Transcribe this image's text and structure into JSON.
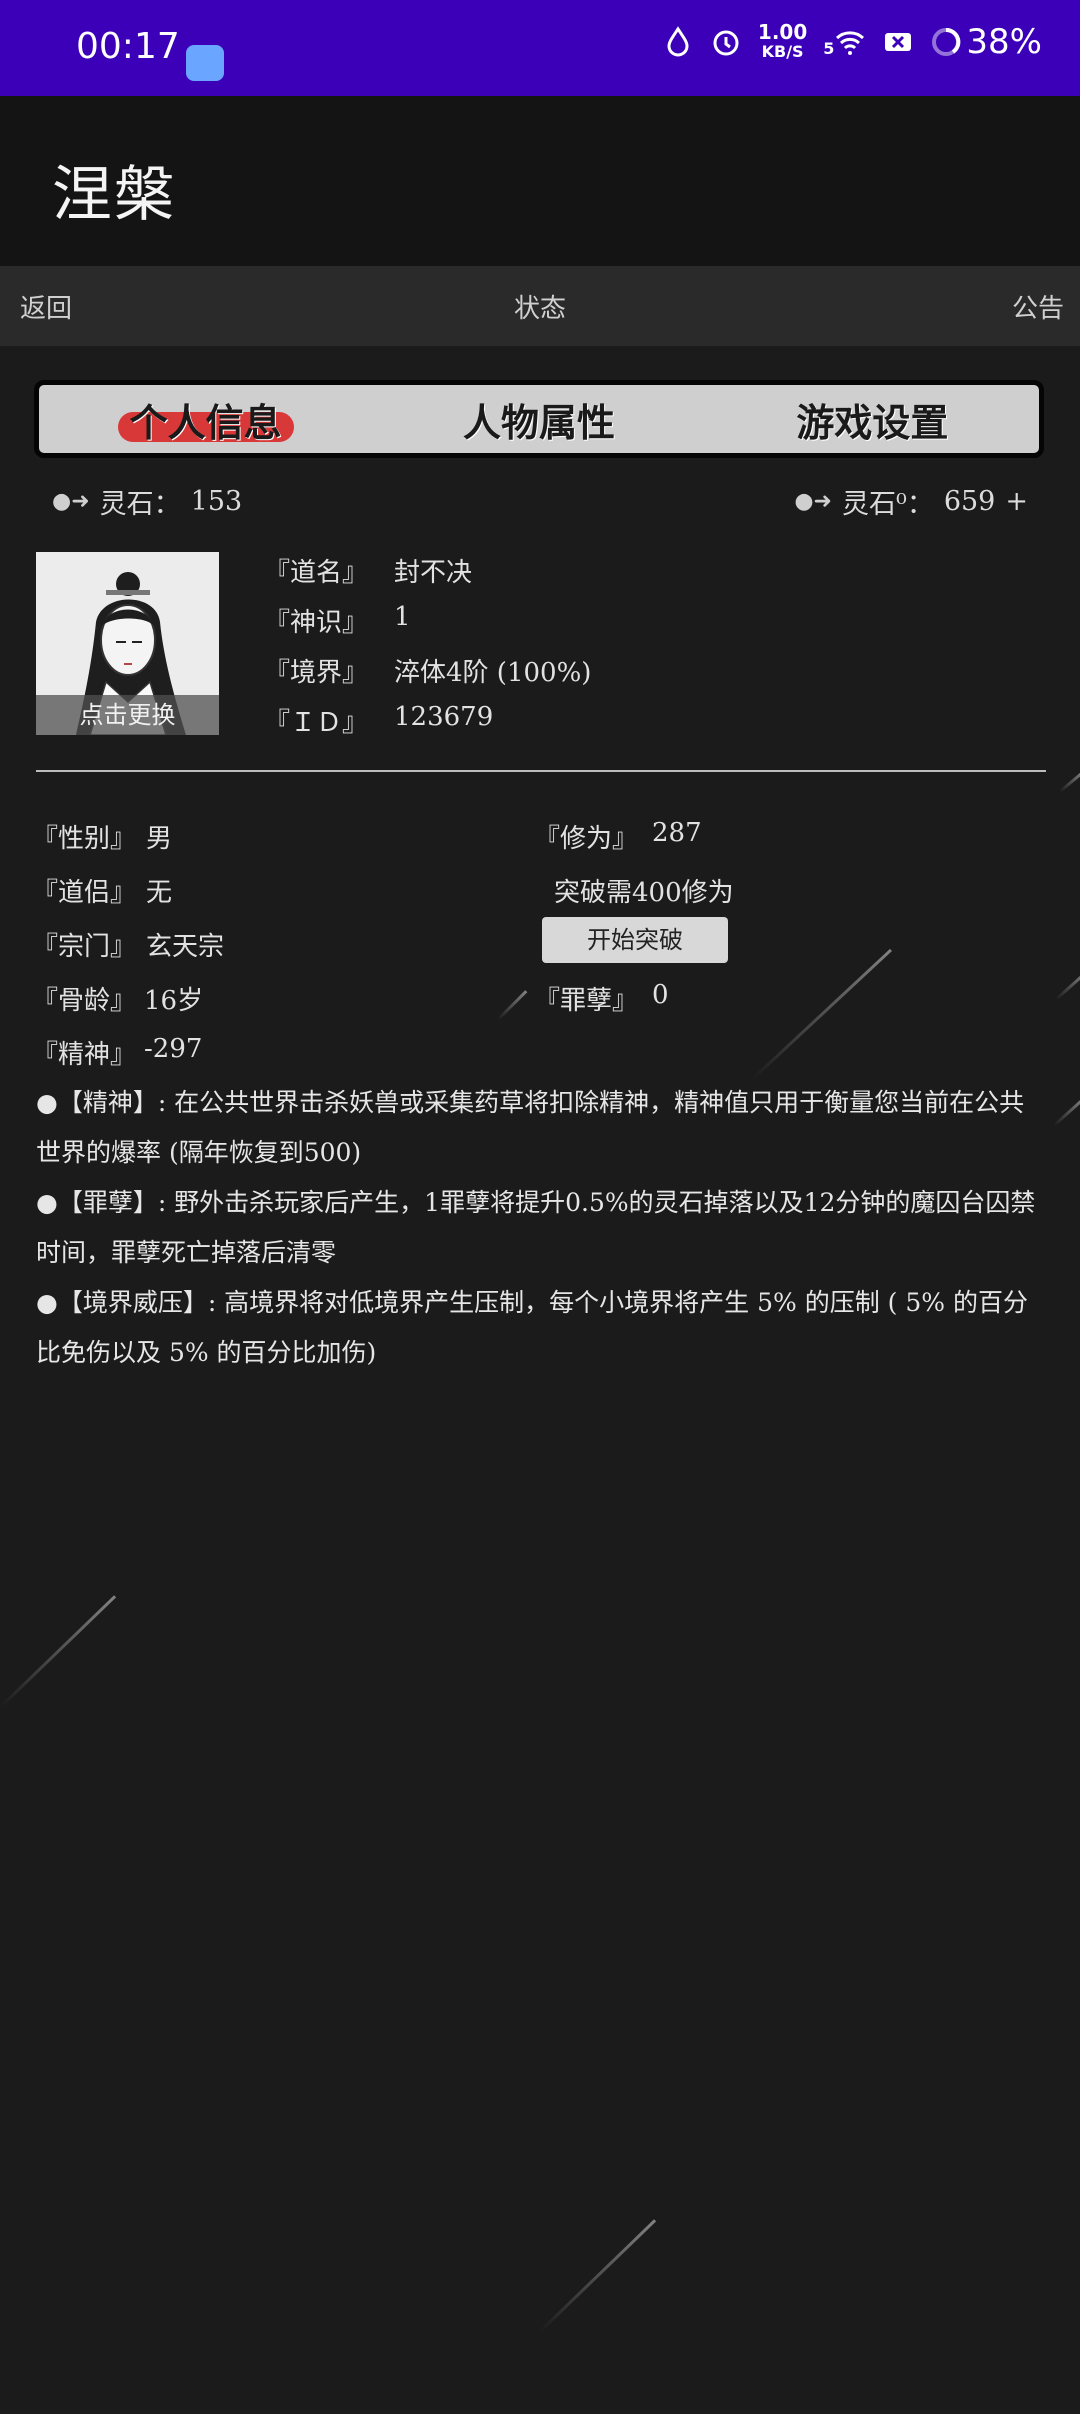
{
  "status_bar": {
    "time": "00:17",
    "speed_value": "1.00",
    "speed_unit": "KB/S",
    "signal_label": "5",
    "battery": "38%"
  },
  "header": {
    "title": "涅槃"
  },
  "nav": {
    "back": "返回",
    "title": "状态",
    "notice": "公告"
  },
  "tabs": [
    {
      "label": "个人信息",
      "active": true
    },
    {
      "label": "人物属性",
      "active": false
    },
    {
      "label": "游戏设置",
      "active": false
    }
  ],
  "currency": {
    "left_label": "灵石：",
    "left_value": "153",
    "right_label": "灵石⁰：",
    "right_value": "659",
    "add": "+"
  },
  "avatar": {
    "caption": "点击更换"
  },
  "profile": [
    {
      "key": "『道名』",
      "value": "封不决"
    },
    {
      "key": "『神识』",
      "value": "1"
    },
    {
      "key": "『境界』",
      "value": "淬体4阶 (100%)"
    },
    {
      "key": "『ＩＤ』",
      "value": "123679"
    }
  ],
  "stats_left": [
    {
      "key": "『性别』",
      "value": "男"
    },
    {
      "key": "『道侣』",
      "value": "无"
    },
    {
      "key": "『宗门』",
      "value": "玄天宗"
    },
    {
      "key": "『骨龄』",
      "value": "16岁"
    },
    {
      "key": "『精神』",
      "value": "-297"
    }
  ],
  "stats_right": {
    "cultivation_key": "『修为』",
    "cultivation_value": "287",
    "breakthrough_need": "突破需400修为",
    "breakthrough_button": "开始突破",
    "sin_key": "『罪孽』",
    "sin_value": "0"
  },
  "notes": [
    "●【精神】: 在公共世界击杀妖兽或采集药草将扣除精神，精神值只用于衡量您当前在公共世界的爆率 (隔年恢复到500)",
    "●【罪孽】: 野外击杀玩家后产生，1罪孽将提升0.5%的灵石掉落以及12分钟的魔囚台囚禁时间，罪孽死亡掉落后清零",
    "●【境界威压】: 高境界将对低境界产生压制，每个小境界将产生 5% 的压制 ( 5% 的百分比免伤以及 5% 的百分比加伤)"
  ]
}
